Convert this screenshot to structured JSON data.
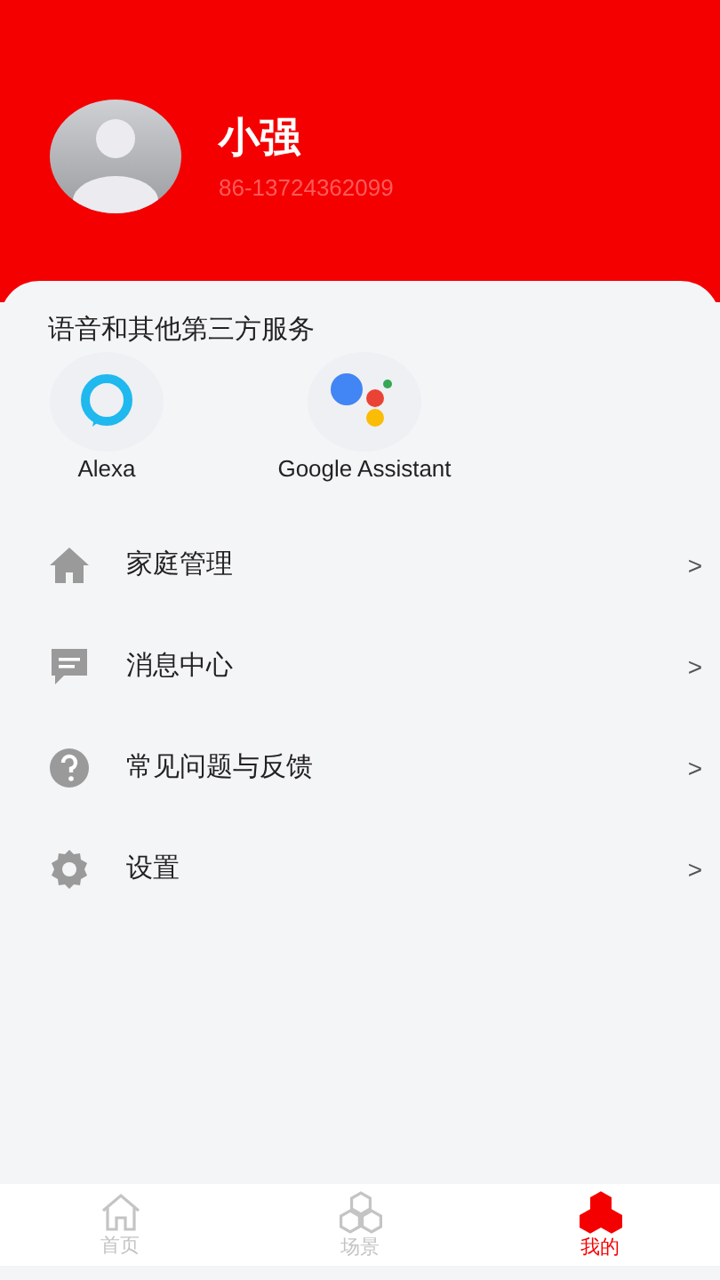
{
  "profile": {
    "name": "小强",
    "phone": "86-13724362099"
  },
  "services": {
    "title": "语音和其他第三方服务",
    "items": [
      {
        "kind": "alexa",
        "label": "Alexa"
      },
      {
        "kind": "google",
        "label": "Google Assistant"
      }
    ]
  },
  "menu": [
    {
      "kind": "home",
      "label": "家庭管理",
      "chevron": ">"
    },
    {
      "kind": "message",
      "label": "消息中心",
      "chevron": ">"
    },
    {
      "kind": "help",
      "label": "常见问题与反馈",
      "chevron": ">"
    },
    {
      "kind": "settings",
      "label": "设置",
      "chevron": ">"
    }
  ],
  "tabs": [
    {
      "kind": "home",
      "label": "首页",
      "selected": false
    },
    {
      "kind": "scenes",
      "label": "场景",
      "selected": false
    },
    {
      "kind": "mine",
      "label": "我的",
      "selected": true
    }
  ]
}
